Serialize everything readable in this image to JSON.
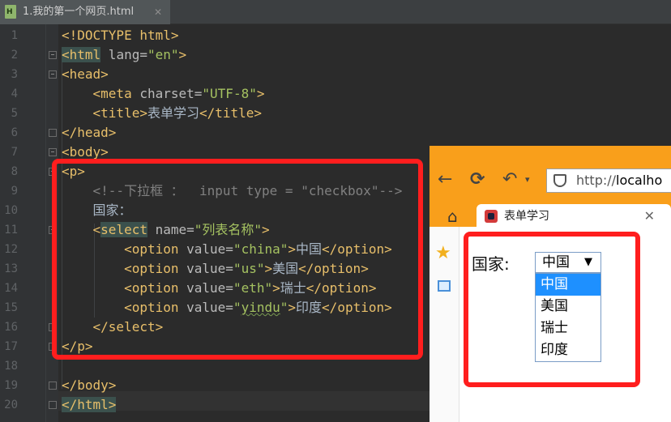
{
  "editor": {
    "tab_title": "1.我的第一个网页.html",
    "tab_close": "✕",
    "line_numbers": [
      "1",
      "2",
      "3",
      "4",
      "5",
      "6",
      "7",
      "8",
      "9",
      "10",
      "11",
      "12",
      "13",
      "14",
      "15",
      "16",
      "17",
      "18",
      "19",
      "20"
    ],
    "code": {
      "l1": {
        "t": "<!DOCTYPE html>"
      },
      "l2": {
        "open": "<html",
        "attr": " lang=",
        "val": "\"en\"",
        "close": ">"
      },
      "l3": {
        "t": "<head>"
      },
      "l4": {
        "open": "<meta",
        "attr": " charset=",
        "val": "\"UTF-8\"",
        "close": ">"
      },
      "l5": {
        "open": "<title>",
        "text": "表单学习",
        "close": "</title>"
      },
      "l6": {
        "t": "</head>"
      },
      "l7": {
        "t": "<body>"
      },
      "l8": {
        "t": "<p>"
      },
      "l9": {
        "comment": "<!--下拉框 ：  input type = \"checkbox\"-->"
      },
      "l10": {
        "text": "国家："
      },
      "l11": {
        "lt": "<",
        "tag": "select",
        "attr": " name=",
        "val": "\"列表名称\"",
        "close": ">"
      },
      "l12": {
        "open": "<option",
        "attr": " value=",
        "val": "\"china\"",
        "close": ">",
        "text": "中国",
        "end": "</option>"
      },
      "l13": {
        "open": "<option",
        "attr": " value=",
        "val": "\"us\"",
        "close": ">",
        "text": "美国",
        "end": "</option>"
      },
      "l14": {
        "open": "<option",
        "attr": " value=",
        "val": "\"eth\"",
        "close": ">",
        "text": "瑞士",
        "end": "</option>"
      },
      "l15": {
        "open": "<option",
        "attr": " value=",
        "valq1": "\"",
        "valsq": "yindu",
        "valq2": "\"",
        "close": ">",
        "text": "印度",
        "end": "</option>"
      },
      "l16": {
        "t": "</select>"
      },
      "l17": {
        "t": "</p>"
      },
      "l19": {
        "t": "</body>"
      },
      "l20": {
        "t": "</html>"
      }
    }
  },
  "browser": {
    "url_text": "http://",
    "url_host": "localho",
    "tab_title": "表单学习",
    "tab_close": "✕",
    "form_label": "国家:",
    "select_value": "中国",
    "select_arrow": "▼",
    "options": [
      "中国",
      "美国",
      "瑞士",
      "印度"
    ]
  },
  "colors": {
    "highlight_box": "#ff1e1e",
    "browser_chrome": "#f99f1b",
    "selected_option": "#1e90ff"
  }
}
